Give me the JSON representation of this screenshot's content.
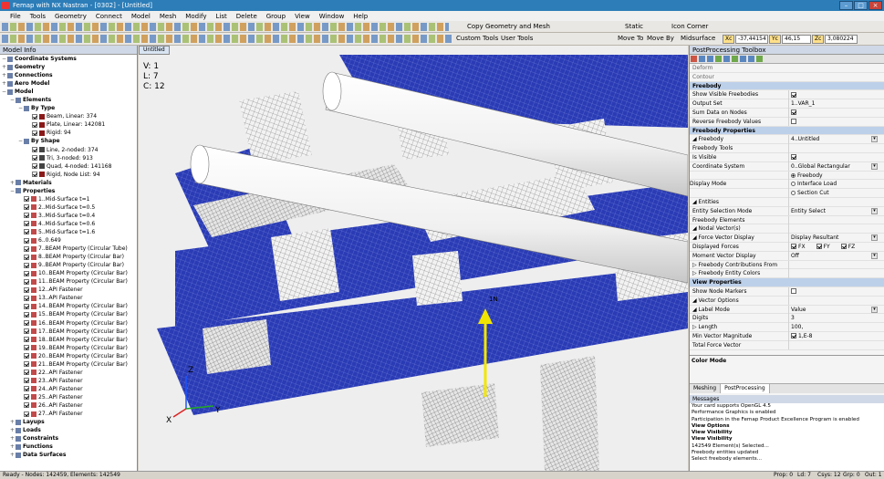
{
  "window": {
    "title": "Femap with NX Nastran - [0302] - [Untitled]"
  },
  "menu": [
    "File",
    "Tools",
    "Geometry",
    "Connect",
    "Model",
    "Mesh",
    "Modify",
    "List",
    "Delete",
    "Group",
    "View",
    "Window",
    "Help"
  ],
  "toolbar": {
    "static_label": "Static",
    "icon_corner_label": "Icon Corner",
    "copy_geometry_label": "Copy Geometry and Mesh",
    "custom_tools_label": "Custom Tools",
    "user_tools_label": "User Tools",
    "move_to_label": "Move To",
    "move_by_label": "Move By",
    "midsurface_label": "Midsurface",
    "xc_label": "Xc",
    "xc_value": "-37,44154",
    "yc_label": "Yc",
    "yc_value": "46,15",
    "zc_label": "Zc",
    "zc_value": "3,080224"
  },
  "model_info": {
    "title": "Model Info",
    "rows": [
      {
        "indent": 0,
        "exp": "−",
        "label": "Coordinate Systems",
        "bold": true,
        "icon": "coord-icon"
      },
      {
        "indent": 0,
        "exp": "+",
        "label": "Geometry",
        "bold": true,
        "icon": "geometry-icon"
      },
      {
        "indent": 0,
        "exp": "+",
        "label": "Connections",
        "bold": true,
        "icon": "connections-icon"
      },
      {
        "indent": 0,
        "exp": "+",
        "label": "Aero Model",
        "bold": true,
        "icon": "aero-icon"
      },
      {
        "indent": 0,
        "exp": "−",
        "label": "Model",
        "bold": true,
        "icon": "model-icon"
      },
      {
        "indent": 1,
        "exp": "−",
        "label": "Elements",
        "bold": true,
        "icon": "elements-icon"
      },
      {
        "indent": 2,
        "exp": "−",
        "label": "By Type",
        "bold": true,
        "icon": "bytype-icon"
      },
      {
        "indent": 3,
        "exp": "",
        "label": "Beam, Linear: 374",
        "cb": true,
        "icon": "beam-icon"
      },
      {
        "indent": 3,
        "exp": "",
        "label": "Plate, Linear: 142081",
        "cb": true,
        "icon": "plate-icon"
      },
      {
        "indent": 3,
        "exp": "",
        "label": "Rigid: 94",
        "cb": true,
        "icon": "rigid-icon"
      },
      {
        "indent": 2,
        "exp": "−",
        "label": "By Shape",
        "bold": true,
        "icon": "byshape-icon"
      },
      {
        "indent": 3,
        "exp": "",
        "label": "Line, 2-noded: 374",
        "cb": true,
        "icon": "line-icon"
      },
      {
        "indent": 3,
        "exp": "",
        "label": "Tri, 3-noded: 913",
        "cb": true,
        "icon": "tri-icon"
      },
      {
        "indent": 3,
        "exp": "",
        "label": "Quad, 4-noded: 141168",
        "cb": true,
        "icon": "quad-icon"
      },
      {
        "indent": 3,
        "exp": "",
        "label": "Rigid, Node List: 94",
        "cb": true,
        "icon": "rigid-icon"
      },
      {
        "indent": 1,
        "exp": "+",
        "label": "Materials",
        "bold": true,
        "icon": "materials-icon"
      },
      {
        "indent": 1,
        "exp": "−",
        "label": "Properties",
        "bold": true,
        "icon": "properties-icon"
      },
      {
        "indent": 2,
        "exp": "",
        "label": "1..Mid-Surface t=1",
        "cb": true,
        "icon": "plate-prop-icon"
      },
      {
        "indent": 2,
        "exp": "",
        "label": "2..Mid-Surface t=0.5",
        "cb": true,
        "icon": "plate-prop-icon"
      },
      {
        "indent": 2,
        "exp": "",
        "label": "3..Mid-Surface t=0.4",
        "cb": true,
        "icon": "plate-prop-icon"
      },
      {
        "indent": 2,
        "exp": "",
        "label": "4..Mid-Surface t=0.6",
        "cb": true,
        "icon": "plate-prop-icon"
      },
      {
        "indent": 2,
        "exp": "",
        "label": "5..Mid-Surface t=1.6",
        "cb": true,
        "icon": "plate-prop-icon"
      },
      {
        "indent": 2,
        "exp": "",
        "label": "6..0.649",
        "cb": true,
        "icon": "plate-prop-icon"
      },
      {
        "indent": 2,
        "exp": "",
        "label": "7..BEAM Property (Circular Tube)",
        "cb": true,
        "icon": "beam-prop-icon"
      },
      {
        "indent": 2,
        "exp": "",
        "label": "8..BEAM Property (Circular Bar)",
        "cb": true,
        "icon": "beam-prop-icon"
      },
      {
        "indent": 2,
        "exp": "",
        "label": "9..BEAM Property (Circular Bar)",
        "cb": true,
        "icon": "beam-prop-icon"
      },
      {
        "indent": 2,
        "exp": "",
        "label": "10..BEAM Property (Circular Bar)",
        "cb": true,
        "icon": "beam-prop-icon"
      },
      {
        "indent": 2,
        "exp": "",
        "label": "11..BEAM Property (Circular Bar)",
        "cb": true,
        "icon": "beam-prop-icon"
      },
      {
        "indent": 2,
        "exp": "",
        "label": "12..API Fastener",
        "cb": true,
        "icon": "fastener-icon"
      },
      {
        "indent": 2,
        "exp": "",
        "label": "13..API Fastener",
        "cb": true,
        "icon": "fastener-icon"
      },
      {
        "indent": 2,
        "exp": "",
        "label": "14..BEAM Property (Circular Bar)",
        "cb": true,
        "icon": "beam-prop-icon"
      },
      {
        "indent": 2,
        "exp": "",
        "label": "15..BEAM Property (Circular Bar)",
        "cb": true,
        "icon": "beam-prop-icon"
      },
      {
        "indent": 2,
        "exp": "",
        "label": "16..BEAM Property (Circular Bar)",
        "cb": true,
        "icon": "beam-prop-icon"
      },
      {
        "indent": 2,
        "exp": "",
        "label": "17..BEAM Property (Circular Bar)",
        "cb": true,
        "icon": "beam-prop-icon"
      },
      {
        "indent": 2,
        "exp": "",
        "label": "18..BEAM Property (Circular Bar)",
        "cb": true,
        "icon": "beam-prop-icon"
      },
      {
        "indent": 2,
        "exp": "",
        "label": "19..BEAM Property (Circular Bar)",
        "cb": true,
        "icon": "beam-prop-icon"
      },
      {
        "indent": 2,
        "exp": "",
        "label": "20..BEAM Property (Circular Bar)",
        "cb": true,
        "icon": "beam-prop-icon"
      },
      {
        "indent": 2,
        "exp": "",
        "label": "21..BEAM Property (Circular Bar)",
        "cb": true,
        "icon": "beam-prop-icon"
      },
      {
        "indent": 2,
        "exp": "",
        "label": "22..API Fastener",
        "cb": true,
        "icon": "fastener-icon"
      },
      {
        "indent": 2,
        "exp": "",
        "label": "23..API Fastener",
        "cb": true,
        "icon": "fastener-icon"
      },
      {
        "indent": 2,
        "exp": "",
        "label": "24..API Fastener",
        "cb": true,
        "icon": "fastener-icon"
      },
      {
        "indent": 2,
        "exp": "",
        "label": "25..API Fastener",
        "cb": true,
        "icon": "fastener-icon"
      },
      {
        "indent": 2,
        "exp": "",
        "label": "26..API Fastener",
        "cb": true,
        "icon": "fastener-icon"
      },
      {
        "indent": 2,
        "exp": "",
        "label": "27..API Fastener",
        "cb": true,
        "icon": "fastener-icon"
      },
      {
        "indent": 1,
        "exp": "+",
        "label": "Layups",
        "bold": true,
        "icon": "layups-icon"
      },
      {
        "indent": 1,
        "exp": "+",
        "label": "Loads",
        "bold": true,
        "icon": "loads-icon"
      },
      {
        "indent": 1,
        "exp": "+",
        "label": "Constraints",
        "bold": true,
        "icon": "constraints-icon"
      },
      {
        "indent": 1,
        "exp": "+",
        "label": "Functions",
        "bold": true,
        "icon": "functions-icon"
      },
      {
        "indent": 1,
        "exp": "+",
        "label": "Data Surfaces",
        "bold": true,
        "icon": "datasurfaces-icon"
      }
    ]
  },
  "viewport": {
    "tab_label": "Untitled",
    "info_v": "V: 1",
    "info_l": "L: 7",
    "info_c": "C: 12",
    "axis_x": "X",
    "axis_y": "Y",
    "axis_z": "Z",
    "load_label": "1N",
    "colors": {
      "background": "#eeeeee",
      "mesh_blue": "#2a3bb5",
      "mesh_white": "#f4f4f4",
      "arrow": "#f2e600"
    }
  },
  "postprocessing": {
    "title": "PostProcessing Toolbox",
    "rows": [
      {
        "type": "dim",
        "label": "Deform"
      },
      {
        "type": "dim",
        "label": "Contour"
      },
      {
        "type": "sec",
        "label": "Freebody"
      },
      {
        "type": "row",
        "label": "Show Visible Freebodies",
        "check": true
      },
      {
        "type": "row",
        "label": "Output Set",
        "value": "1..VAR_1"
      },
      {
        "type": "row",
        "label": "Sum Data on Nodes",
        "check": true
      },
      {
        "type": "row",
        "label": "Reverse Freebody Values",
        "check": false
      },
      {
        "type": "sec",
        "label": "Freebody Properties"
      },
      {
        "type": "row",
        "label": "◢ Freebody",
        "value": "4..Untitled",
        "dd": true
      },
      {
        "type": "row",
        "label": "    Freebody Tools",
        "value": ""
      },
      {
        "type": "row",
        "label": "    Is Visible",
        "check": true
      },
      {
        "type": "row",
        "label": "    Coordinate System",
        "value": "0..Global Rectangular",
        "dd": true
      },
      {
        "type": "radio",
        "label": "    Display Mode",
        "options": [
          "Freebody",
          "Interface Load",
          "Section Cut"
        ],
        "selected": 0
      },
      {
        "type": "row",
        "label": "◢ Entities",
        "value": ""
      },
      {
        "type": "row",
        "label": "    Entity Selection Mode",
        "value": "Entity Select",
        "dd": true
      },
      {
        "type": "row",
        "label": "    Freebody Elements",
        "value": ""
      },
      {
        "type": "row",
        "label": "◢ Nodal Vector(s)",
        "value": ""
      },
      {
        "type": "row",
        "label": "    ◢ Force Vector Display",
        "value": "Display Resultant",
        "dd": true
      },
      {
        "type": "xyz",
        "label": "        Displayed Forces",
        "options": [
          "FX",
          "FY",
          "FZ"
        ]
      },
      {
        "type": "row",
        "label": "        Moment Vector Display",
        "value": "Off",
        "dd": true
      },
      {
        "type": "row",
        "label": "  ▷ Freebody Contributions From",
        "value": ""
      },
      {
        "type": "row",
        "label": "  ▷ Freebody Entity Colors",
        "value": ""
      },
      {
        "type": "sec",
        "label": "View Properties"
      },
      {
        "type": "row",
        "label": "Show Node Markers",
        "check": false
      },
      {
        "type": "row",
        "label": "◢ Vector Options",
        "value": ""
      },
      {
        "type": "row",
        "label": "    ◢ Label Mode",
        "value": "Value",
        "dd": true
      },
      {
        "type": "row",
        "label": "        Digits",
        "value": "3"
      },
      {
        "type": "row",
        "label": "    ▷ Length",
        "value": "100,"
      },
      {
        "type": "row",
        "label": "    Min Vector Magnitude",
        "value": "1,E-8",
        "checkval": true
      },
      {
        "type": "row",
        "label": "    Total Force Vector",
        "value": ""
      }
    ],
    "color_mode_label": "Color Mode"
  },
  "bottom_tabs": {
    "meshing": "Meshing",
    "postprocessing": "PostProcessing"
  },
  "messages": {
    "title": "Messages",
    "lines": [
      "Your card supports OpenGL 4.5",
      "Performance Graphics is enabled",
      "Participation in the Femap Product Excellence Program is enabled",
      "View Options",
      "View Visibility",
      "View Visibility",
      "142549 Element(s) Selected...",
      "Freebody entities updated",
      "Select freebody elements..."
    ],
    "bold_lines": [
      3,
      4,
      5
    ]
  },
  "status": {
    "left": "Ready - Nodes: 142459, Elements: 142549",
    "prop": "Prop: 0",
    "ld": "Ld: 7",
    "csys": "Csys: 12",
    "grp": "Grp: 0",
    "out": "Out: 1"
  }
}
